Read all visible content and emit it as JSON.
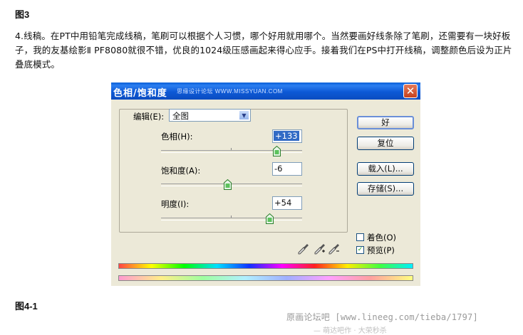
{
  "doc": {
    "fig3_title": "图3",
    "paragraph": "4.线稿。在PT中用铅笔完成线稿，笔刷可以根据个人习惯，哪个好用就用哪个。当然要画好线条除了笔刷，还需要有一块好板子，我的友基绘影Ⅱ PF8080就很不错，优良的1024级压感画起来得心应手。接着我们在PS中打开线稿，调整颜色后设为正片叠底模式。",
    "fig41_title": "图4-1",
    "watermark": "原画论坛吧 [www.lineeg.com/tieba/1797]",
    "watermark2": "— 萌达吧作 · 大荣秒杀"
  },
  "dialog": {
    "title": "色相/饱和度",
    "title_watermark": "思缘设计论坛 WWW.MISSYUAN.COM",
    "close_glyph": "✕",
    "edit_label": "编辑(E):",
    "edit_value": "全图",
    "hue_label": "色相(H):",
    "hue_value": "+133",
    "hue_pct": 0.82,
    "sat_label": "饱和度(A):",
    "sat_value": "-6",
    "sat_pct": 0.47,
    "light_label": "明度(I):",
    "light_value": "+54",
    "light_pct": 0.77,
    "btn_ok": "好",
    "btn_reset": "复位",
    "btn_load": "载入(L)...",
    "btn_save": "存储(S)...",
    "colorize_label": "着色(O)",
    "colorize_checked": false,
    "preview_label": "预览(P)",
    "preview_checked": true,
    "preview_mark": "✓"
  }
}
